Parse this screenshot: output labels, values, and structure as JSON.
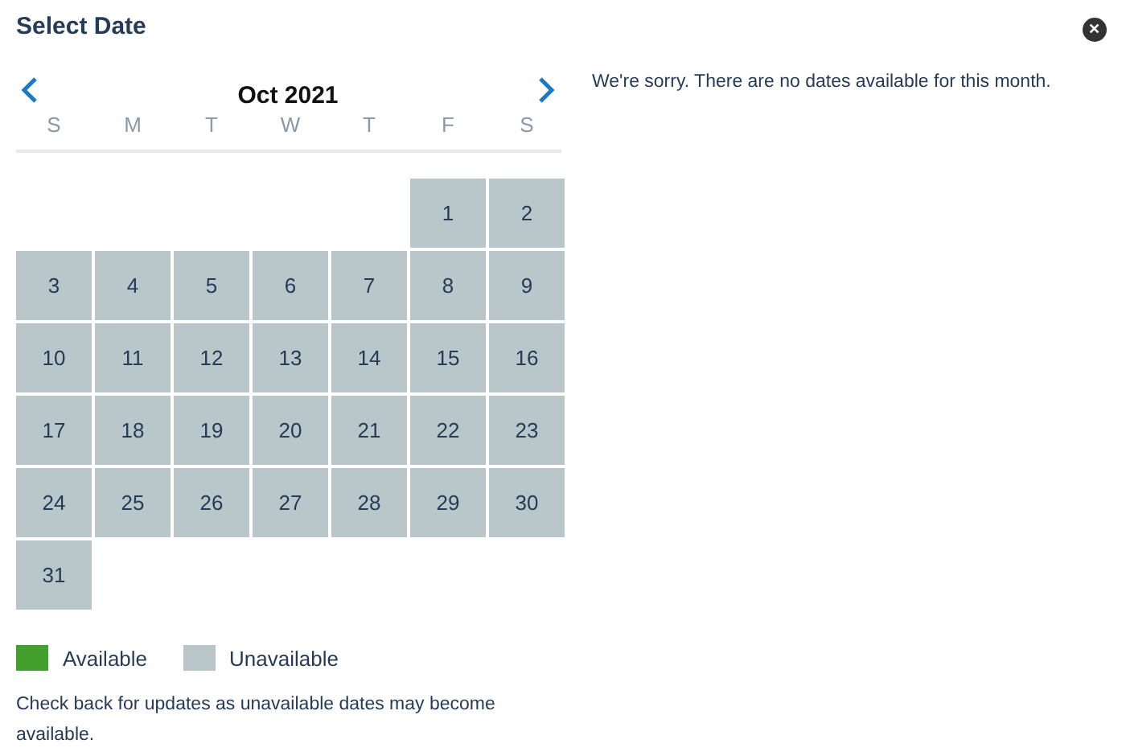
{
  "title": "Select Date",
  "close": "✕",
  "calendar": {
    "month": "Oct  2021",
    "weekdays": [
      "S",
      "M",
      "T",
      "W",
      "T",
      "F",
      "S"
    ],
    "weeks": [
      [
        {
          "kind": "blank"
        },
        {
          "kind": "blank"
        },
        {
          "kind": "blank"
        },
        {
          "kind": "blank"
        },
        {
          "kind": "blank"
        },
        {
          "kind": "day",
          "label": "1",
          "available": false
        },
        {
          "kind": "day",
          "label": "2",
          "available": false
        }
      ],
      [
        {
          "kind": "day",
          "label": "3",
          "available": false
        },
        {
          "kind": "day",
          "label": "4",
          "available": false
        },
        {
          "kind": "day",
          "label": "5",
          "available": false
        },
        {
          "kind": "day",
          "label": "6",
          "available": false
        },
        {
          "kind": "day",
          "label": "7",
          "available": false
        },
        {
          "kind": "day",
          "label": "8",
          "available": false
        },
        {
          "kind": "day",
          "label": "9",
          "available": false
        }
      ],
      [
        {
          "kind": "day",
          "label": "10",
          "available": false
        },
        {
          "kind": "day",
          "label": "11",
          "available": false
        },
        {
          "kind": "day",
          "label": "12",
          "available": false
        },
        {
          "kind": "day",
          "label": "13",
          "available": false
        },
        {
          "kind": "day",
          "label": "14",
          "available": false
        },
        {
          "kind": "day",
          "label": "15",
          "available": false
        },
        {
          "kind": "day",
          "label": "16",
          "available": false
        }
      ],
      [
        {
          "kind": "day",
          "label": "17",
          "available": false
        },
        {
          "kind": "day",
          "label": "18",
          "available": false
        },
        {
          "kind": "day",
          "label": "19",
          "available": false
        },
        {
          "kind": "day",
          "label": "20",
          "available": false
        },
        {
          "kind": "day",
          "label": "21",
          "available": false
        },
        {
          "kind": "day",
          "label": "22",
          "available": false
        },
        {
          "kind": "day",
          "label": "23",
          "available": false
        }
      ],
      [
        {
          "kind": "day",
          "label": "24",
          "available": false
        },
        {
          "kind": "day",
          "label": "25",
          "available": false
        },
        {
          "kind": "day",
          "label": "26",
          "available": false
        },
        {
          "kind": "day",
          "label": "27",
          "available": false
        },
        {
          "kind": "day",
          "label": "28",
          "available": false
        },
        {
          "kind": "day",
          "label": "29",
          "available": false
        },
        {
          "kind": "day",
          "label": "30",
          "available": false
        }
      ],
      [
        {
          "kind": "day",
          "label": "31",
          "available": false
        }
      ]
    ]
  },
  "legend": [
    {
      "label": "Available",
      "color": "#43a02c"
    },
    {
      "label": "Unavailable",
      "color": "#b9c6ca"
    }
  ],
  "note": "Check back for updates as unavailable dates may become available.",
  "message": "We're sorry. There are no dates available for this month."
}
